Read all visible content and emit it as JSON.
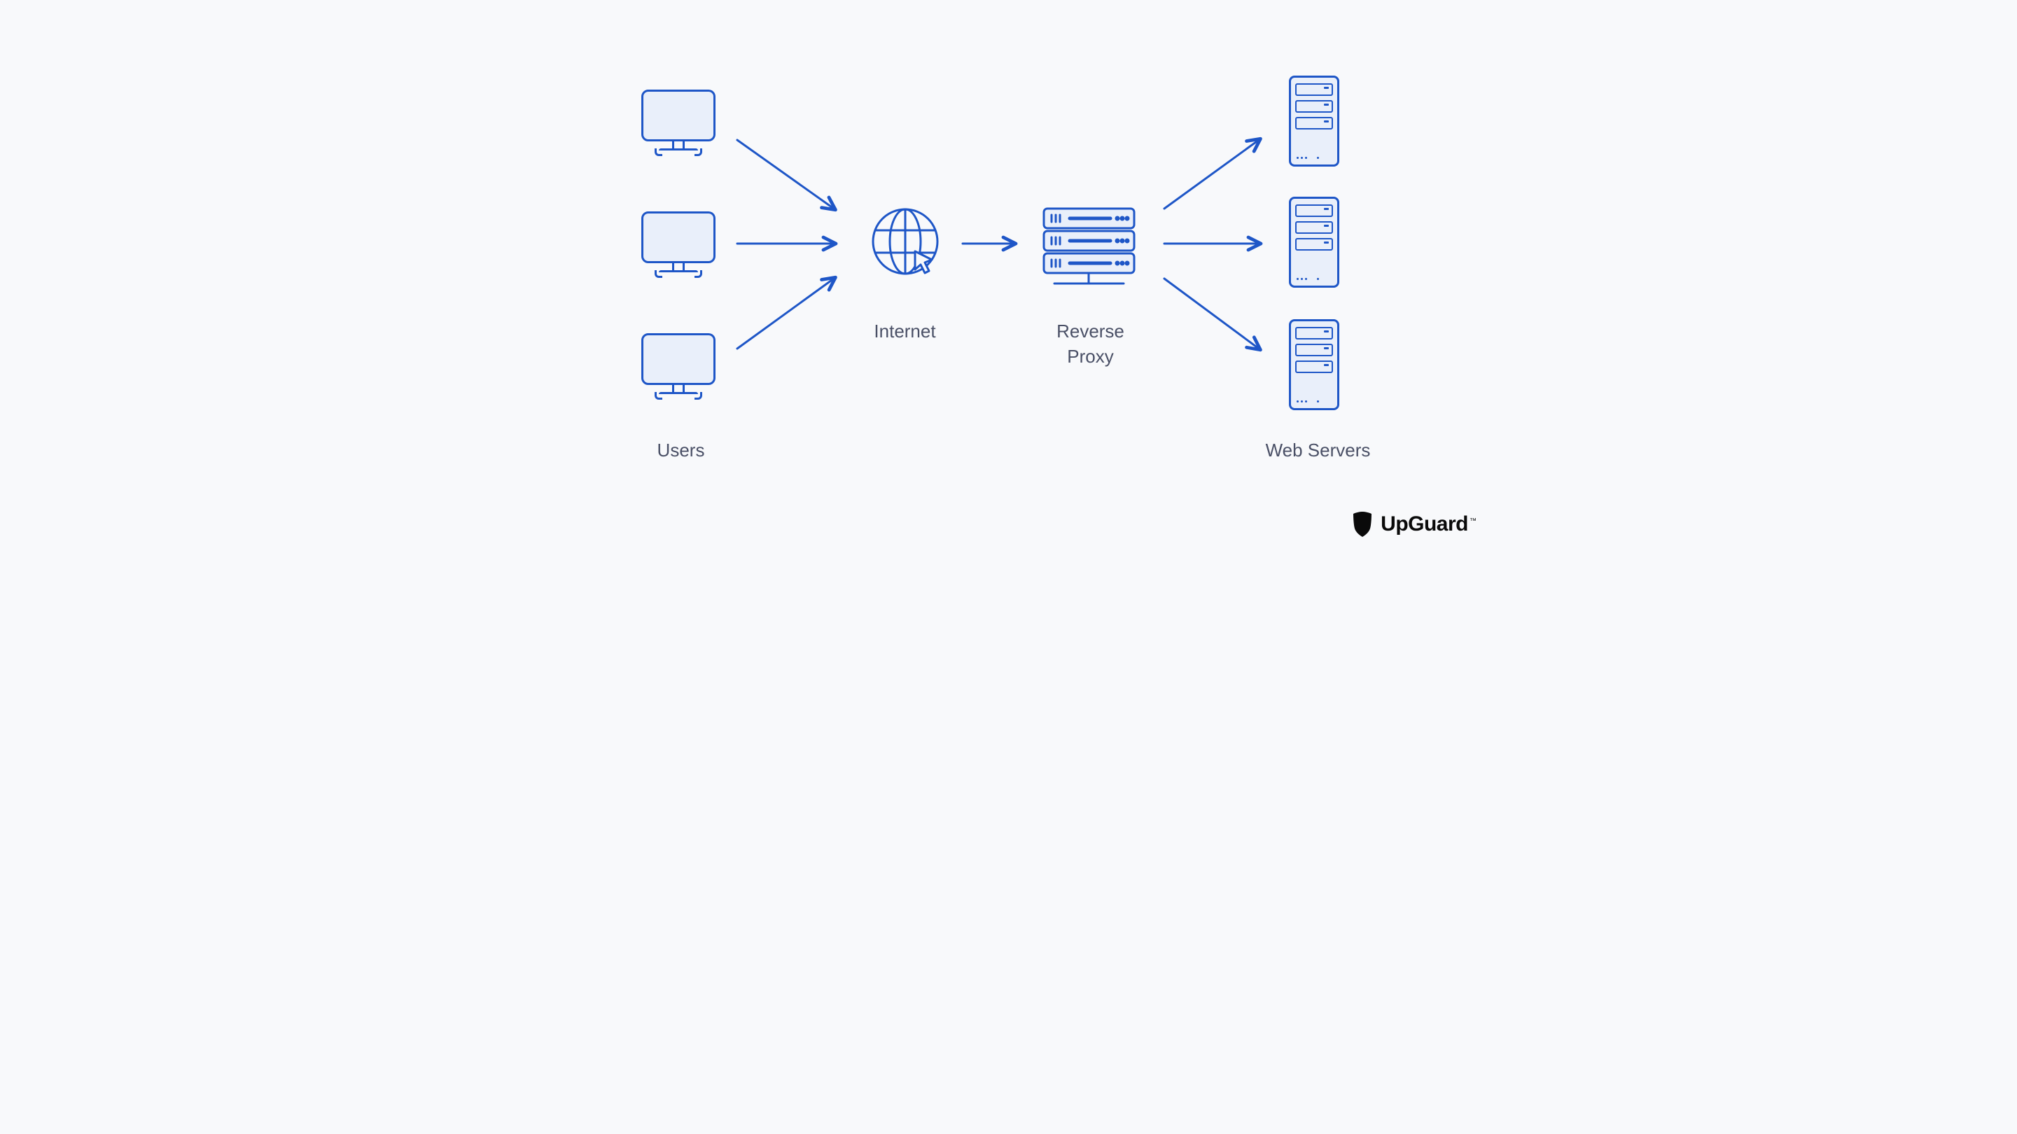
{
  "labels": {
    "users": "Users",
    "internet": "Internet",
    "reverse_proxy": "Reverse\nProxy",
    "web_servers": "Web Servers"
  },
  "brand": {
    "name": "UpGuard",
    "trademark": "™"
  },
  "nodes": {
    "user_clients": 3,
    "web_servers": 3,
    "internet": 1,
    "reverse_proxy": 1
  },
  "flows": [
    {
      "from": "user-1",
      "to": "internet"
    },
    {
      "from": "user-2",
      "to": "internet"
    },
    {
      "from": "user-3",
      "to": "internet"
    },
    {
      "from": "internet",
      "to": "reverse-proxy"
    },
    {
      "from": "reverse-proxy",
      "to": "server-1"
    },
    {
      "from": "reverse-proxy",
      "to": "server-2"
    },
    {
      "from": "reverse-proxy",
      "to": "server-3"
    }
  ],
  "colors": {
    "stroke": "#1e56c7",
    "fill": "#e9effa",
    "text": "#4a5066",
    "bg": "#f8f9fb",
    "logo": "#0a0a0a"
  }
}
